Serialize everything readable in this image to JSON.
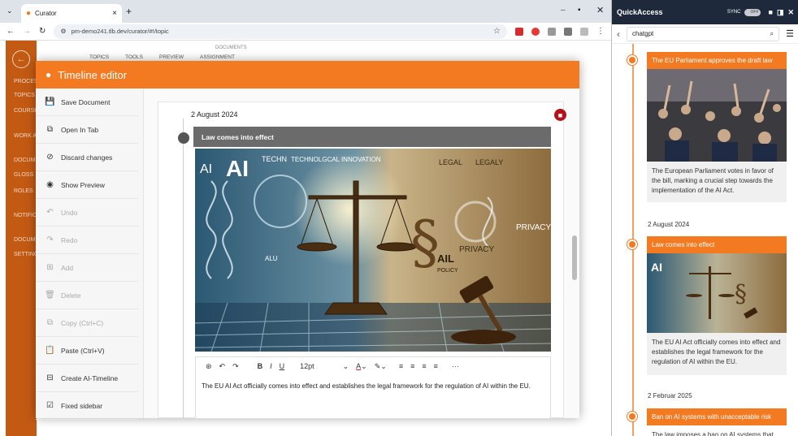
{
  "browser": {
    "tab_title": "Curator",
    "url": "pm-demo241.tlb.dev/curator/#!/topic",
    "new_tab_label": "+"
  },
  "background_nav": {
    "items": [
      "PROCESS",
      "TOPICS",
      "COURSES",
      "WORK A",
      "DOCUM",
      "GLOSS",
      "ROLES",
      "NOTIFIC",
      "DOCUM",
      "SETTINGS"
    ]
  },
  "background_tabs": [
    "TOPICS",
    "TOOLS",
    "PREVIEW",
    "ASSIGNMENT"
  ],
  "background_doc_label": "DOCUMENTS",
  "dialog": {
    "title": "Timeline editor",
    "menu": [
      {
        "label": "Save Document",
        "icon": "save-icon",
        "enabled": true
      },
      {
        "label": "Open In Tab",
        "icon": "open-in-tab-icon",
        "enabled": true
      },
      {
        "label": "Discard changes",
        "icon": "discard-icon",
        "enabled": true
      },
      {
        "label": "Show Preview",
        "icon": "eye-icon",
        "enabled": true
      },
      {
        "label": "Undo",
        "icon": "undo-icon",
        "enabled": false
      },
      {
        "label": "Redo",
        "icon": "redo-icon",
        "enabled": false
      },
      {
        "label": "Add",
        "icon": "add-icon",
        "enabled": false
      },
      {
        "label": "Delete",
        "icon": "trash-icon",
        "enabled": false
      },
      {
        "label": "Copy (Ctrl+C)",
        "icon": "copy-icon",
        "enabled": false
      },
      {
        "label": "Paste (Ctrl+V)",
        "icon": "paste-icon",
        "enabled": true
      },
      {
        "label": "Create AI-Timeline",
        "icon": "ai-timeline-icon",
        "enabled": true
      },
      {
        "label": "Fixed sidebar",
        "icon": "checkbox-icon",
        "enabled": true
      }
    ],
    "entry": {
      "date": "2 August 2024",
      "title": "Law comes into effect",
      "image_words": [
        "AI",
        "AI",
        "TECHN",
        "TECHNOLGCAL INNOVATION",
        "LEGAL",
        "LEGALY",
        "PRIVACY",
        "PRIVACY",
        "AIL",
        "POLICY",
        "ALU"
      ],
      "editor": {
        "font_size": "12pt",
        "text": "The EU AI Act officially comes into effect and establishes the legal framework for the regulation of AI within the EU."
      }
    }
  },
  "quickaccess": {
    "title": "QuickAccess",
    "sync_label": "SYNC",
    "sync_state": "OFF",
    "search_value": "chatgpt",
    "events": [
      {
        "banner": "The EU Parliament approves the draft law",
        "text": "The European Parliament votes in favor of the bill, marking a crucial step towards the implementation of the AI Act.",
        "date": ""
      },
      {
        "date": "2 August 2024",
        "banner": "Law comes into effect",
        "text": "The EU AI Act officially comes into effect and establishes the legal framework for the regulation of AI within the EU."
      },
      {
        "date": "2 Februar 2025",
        "banner": "Ban on AI systems with unacceptable risk",
        "text": "The law imposes a ban on AI systems that"
      }
    ]
  },
  "colors": {
    "accent": "#f37a20",
    "nav": "#c25a13",
    "qa_header": "#1e2a3b",
    "delete": "#b3141c"
  }
}
